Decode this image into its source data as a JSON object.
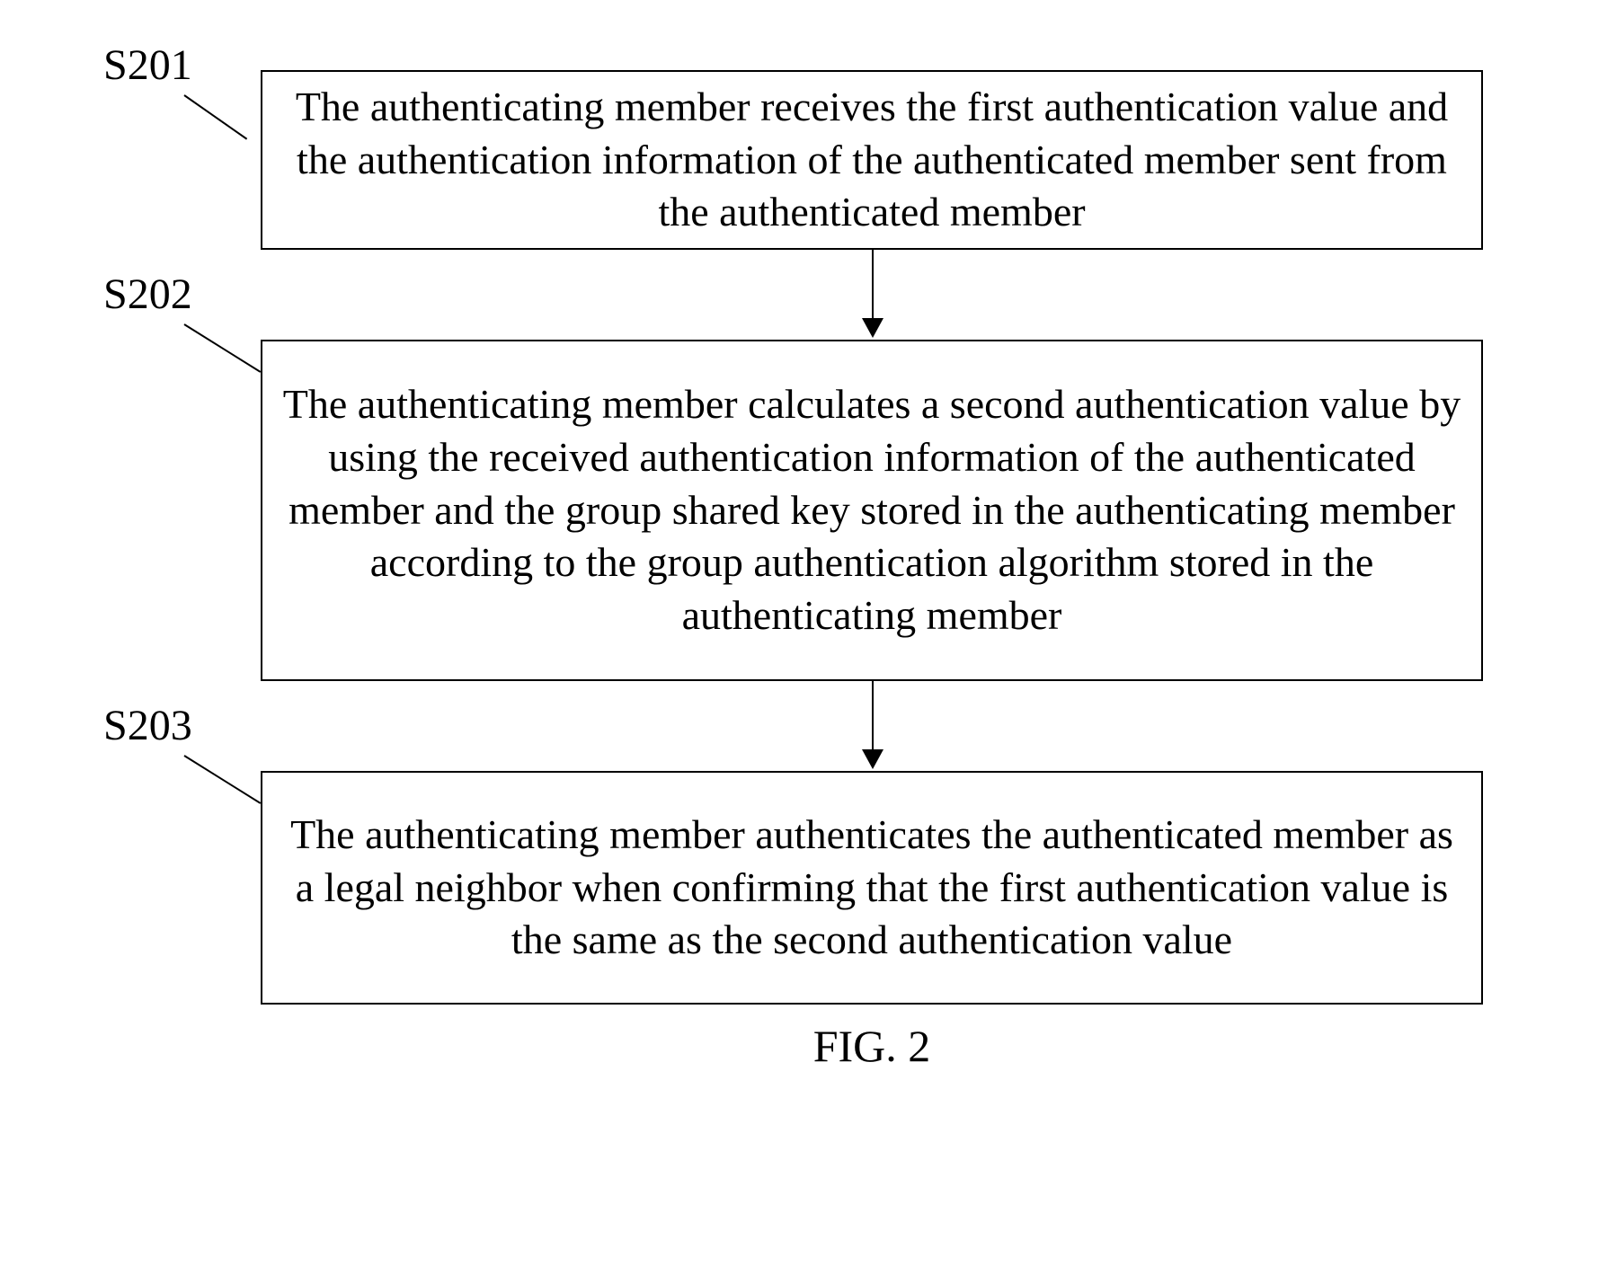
{
  "steps": {
    "s201": {
      "label": "S201",
      "text": "The authenticating member receives the first authentication value and the authentication information of the authenticated member sent from the authenticated member"
    },
    "s202": {
      "label": "S202",
      "text": "The authenticating member calculates a second authentication value by using the received authentication information of the authenticated member and the group shared key stored in the authenticating member according to the group authentication algorithm stored in the authenticating member"
    },
    "s203": {
      "label": "S203",
      "text": "The authenticating member authenticates the authenticated member as a legal neighbor when confirming that the first authentication value is the same as the second authentication value"
    }
  },
  "caption": "FIG. 2"
}
